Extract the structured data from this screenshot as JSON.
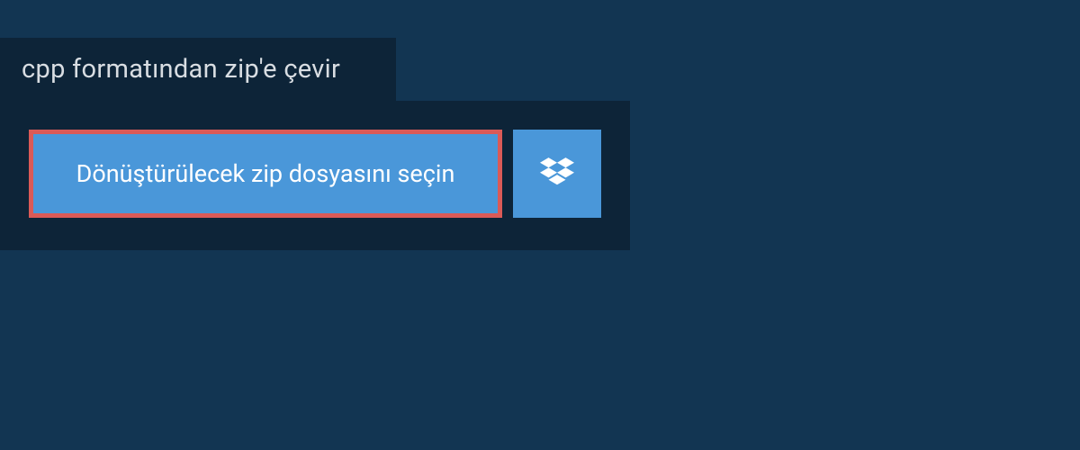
{
  "header": {
    "title": "cpp formatından zip'e çevir"
  },
  "upload": {
    "select_label": "Dönüştürülecek zip dosyasını seçin",
    "dropbox_icon": "dropbox-icon"
  },
  "colors": {
    "page_bg": "#123552",
    "panel_bg": "#0d2438",
    "button_bg": "#4a97d9",
    "highlight_border": "#db5a57",
    "text_light": "#d8dde2"
  }
}
